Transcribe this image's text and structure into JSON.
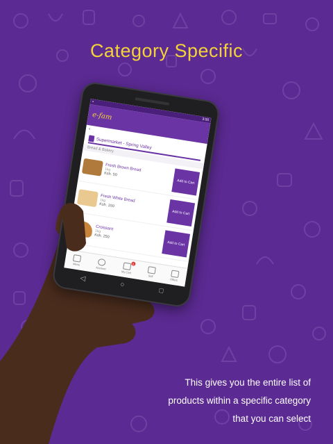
{
  "headline": "Category Specific",
  "caption": {
    "line1": "This gives you the entire list of",
    "line2": "products within a specific category",
    "line3": "that you can select"
  },
  "colors": {
    "background": "#5b2a92",
    "headline": "#f3d23a",
    "app_primary": "#6b34a5",
    "badge": "#e23b3b"
  },
  "app": {
    "status_time": "3:00",
    "brand": "e-fam",
    "back_icon": "back-arrow-icon",
    "store_name": "Supermarket - Spring Valley",
    "category": "Bread & Bakery",
    "add_label": "Add to Cart",
    "products": [
      {
        "name": "Fresh Brown Bread",
        "unit": "1kg",
        "price": "Ksh. 50"
      },
      {
        "name": "Fresh White Bread",
        "unit": "1kg",
        "price": "Ksh. 150"
      },
      {
        "name": "Croissant",
        "unit": "1kg",
        "price": "Ksh. 250"
      }
    ],
    "nav": [
      {
        "label": "Menu",
        "icon": "menu-icon"
      },
      {
        "label": "Account",
        "icon": "user-icon"
      },
      {
        "label": "My Cart",
        "icon": "cart-icon",
        "badge": "2"
      },
      {
        "label": "Sell",
        "icon": "basket-icon"
      },
      {
        "label": "Offers",
        "icon": "offer-icon"
      }
    ]
  }
}
